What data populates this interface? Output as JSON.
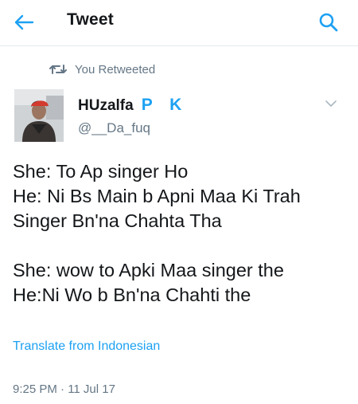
{
  "header": {
    "title": "Tweet",
    "back_icon": "arrow-left-icon",
    "search_icon": "search-icon",
    "accent_color": "#1da1f2"
  },
  "retweet": {
    "icon": "retweet-icon",
    "label": "You Retweeted"
  },
  "author": {
    "display_name": "HUzalfa",
    "name_badge": "P K",
    "handle": "@__Da_fuq",
    "menu_icon": "chevron-down-icon"
  },
  "tweet": {
    "paragraphs": [
      [
        "She: To Ap singer Ho",
        "He: Ni Bs Main b Apni Maa Ki Trah",
        "Singer Bn'na Chahta Tha"
      ],
      [
        "She: wow to Apki Maa singer the",
        "He:Ni Wo b Bn'na Chahti the"
      ]
    ],
    "translate_label": "Translate from Indonesian",
    "timestamp": "9:25 PM · 11 Jul 17"
  }
}
